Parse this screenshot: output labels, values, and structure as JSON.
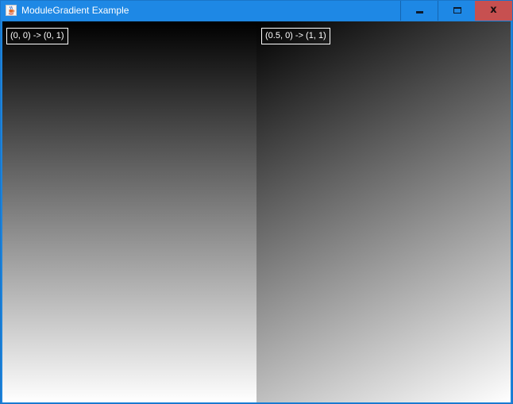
{
  "window": {
    "title": "ModuleGradient Example",
    "app_icon": "java-coffee-cup-icon",
    "controls": {
      "minimize": "minimize-icon",
      "maximize": "maximize-icon",
      "close": "close-icon",
      "close_glyph": "x"
    }
  },
  "panels": [
    {
      "label": "(0, 0) -> (0, 1)",
      "gradient_from": "#000000",
      "gradient_to": "#ffffff"
    },
    {
      "label": "(0.5, 0) -> (1, 1)",
      "gradient_from": "#000000",
      "gradient_to": "#ffffff"
    }
  ],
  "colors": {
    "titlebar": "#1e88e5",
    "close_hover": "#c75050",
    "label_border": "#ffffff"
  }
}
